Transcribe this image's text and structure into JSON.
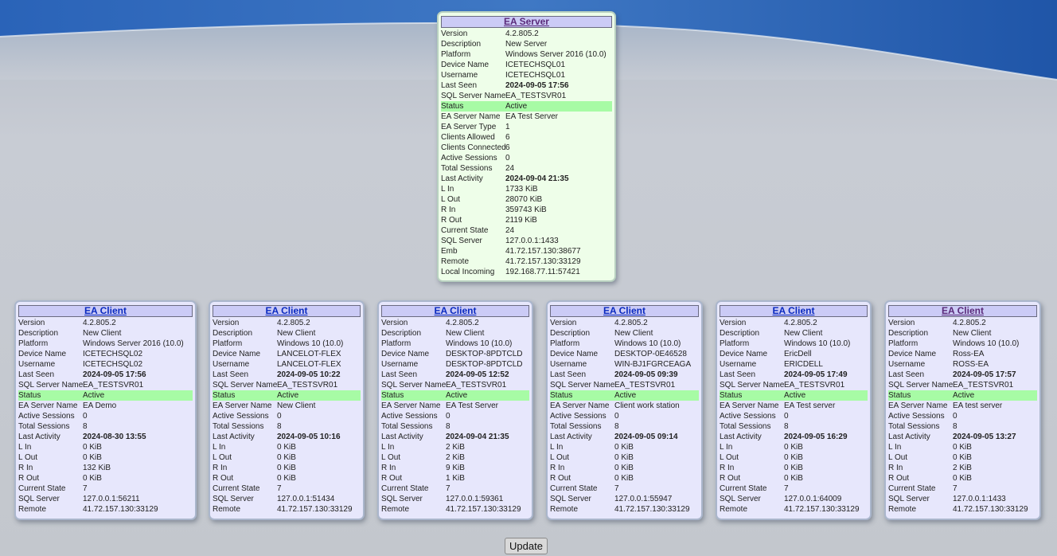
{
  "server": {
    "title": "EA Server",
    "rows": [
      {
        "label": "Version",
        "value": "4.2.805.2"
      },
      {
        "label": "Description",
        "value": "New Server"
      },
      {
        "label": "Platform",
        "value": "Windows Server 2016 (10.0)"
      },
      {
        "label": "Device Name",
        "value": "ICETECHSQL01"
      },
      {
        "label": "Username",
        "value": "ICETECHSQL01"
      },
      {
        "label": "Last Seen",
        "value": "2024-09-05 17:56",
        "bold": true
      },
      {
        "label": "SQL Server Name",
        "value": "EA_TESTSVR01"
      },
      {
        "label": "Status",
        "value": "Active",
        "status": "active"
      },
      {
        "label": "EA Server Name",
        "value": "EA Test Server"
      },
      {
        "label": "EA Server Type",
        "value": "1"
      },
      {
        "label": "Clients Allowed",
        "value": "6"
      },
      {
        "label": "Clients Connected",
        "value": "6"
      },
      {
        "label": "Active Sessions",
        "value": "0"
      },
      {
        "label": "Total Sessions",
        "value": "24"
      },
      {
        "label": "Last Activity",
        "value": "2024-09-04 21:35",
        "bold": true
      },
      {
        "label": "L In",
        "value": "1733 KiB"
      },
      {
        "label": "L Out",
        "value": "28070 KiB"
      },
      {
        "label": "R In",
        "value": "359743 KiB"
      },
      {
        "label": "R Out",
        "value": "2119 KiB"
      },
      {
        "label": "Current State",
        "value": "24"
      },
      {
        "label": "SQL Server",
        "value": "127.0.0.1:1433"
      },
      {
        "label": "Emb",
        "value": "41.72.157.130:38677"
      },
      {
        "label": "Remote",
        "value": "41.72.157.130:33129"
      },
      {
        "label": "Local Incoming",
        "value": "192.168.77.11:57421"
      }
    ]
  },
  "clients": [
    {
      "title": "EA Client",
      "rows": [
        {
          "label": "Version",
          "value": "4.2.805.2"
        },
        {
          "label": "Description",
          "value": "New Client"
        },
        {
          "label": "Platform",
          "value": "Windows Server 2016 (10.0)"
        },
        {
          "label": "Device Name",
          "value": "ICETECHSQL02"
        },
        {
          "label": "Username",
          "value": "ICETECHSQL02"
        },
        {
          "label": "Last Seen",
          "value": "2024-09-05 17:56",
          "bold": true
        },
        {
          "label": "SQL Server Name",
          "value": "EA_TESTSVR01"
        },
        {
          "label": "Status",
          "value": "Active",
          "status": "active"
        },
        {
          "label": "EA Server Name",
          "value": "EA Demo"
        },
        {
          "label": "Active Sessions",
          "value": "0"
        },
        {
          "label": "Total Sessions",
          "value": "8"
        },
        {
          "label": "Last Activity",
          "value": "2024-08-30 13:55",
          "bold": true
        },
        {
          "label": "L In",
          "value": "0 KiB"
        },
        {
          "label": "L Out",
          "value": "0 KiB"
        },
        {
          "label": "R In",
          "value": "132 KiB"
        },
        {
          "label": "R Out",
          "value": "0 KiB"
        },
        {
          "label": "Current State",
          "value": "7"
        },
        {
          "label": "SQL Server",
          "value": "127.0.0.1:56211"
        },
        {
          "label": "Remote",
          "value": "41.72.157.130:33129"
        }
      ]
    },
    {
      "title": "EA Client",
      "rows": [
        {
          "label": "Version",
          "value": "4.2.805.2"
        },
        {
          "label": "Description",
          "value": "New Client"
        },
        {
          "label": "Platform",
          "value": "Windows 10 (10.0)"
        },
        {
          "label": "Device Name",
          "value": "LANCELOT-FLEX"
        },
        {
          "label": "Username",
          "value": "LANCELOT-FLEX"
        },
        {
          "label": "Last Seen",
          "value": "2024-09-05 10:22",
          "bold": true
        },
        {
          "label": "SQL Server Name",
          "value": "EA_TESTSVR01"
        },
        {
          "label": "Status",
          "value": "Active",
          "status": "active"
        },
        {
          "label": "EA Server Name",
          "value": "New Client"
        },
        {
          "label": "Active Sessions",
          "value": "0"
        },
        {
          "label": "Total Sessions",
          "value": "8"
        },
        {
          "label": "Last Activity",
          "value": "2024-09-05 10:16",
          "bold": true
        },
        {
          "label": "L In",
          "value": "0 KiB"
        },
        {
          "label": "L Out",
          "value": "0 KiB"
        },
        {
          "label": "R In",
          "value": "0 KiB"
        },
        {
          "label": "R Out",
          "value": "0 KiB"
        },
        {
          "label": "Current State",
          "value": "7"
        },
        {
          "label": "SQL Server",
          "value": "127.0.0.1:51434"
        },
        {
          "label": "Remote",
          "value": "41.72.157.130:33129"
        }
      ]
    },
    {
      "title": "EA Client",
      "rows": [
        {
          "label": "Version",
          "value": "4.2.805.2"
        },
        {
          "label": "Description",
          "value": "New Client"
        },
        {
          "label": "Platform",
          "value": "Windows 10 (10.0)"
        },
        {
          "label": "Device Name",
          "value": "DESKTOP-8PDTCLD"
        },
        {
          "label": "Username",
          "value": "DESKTOP-8PDTCLD"
        },
        {
          "label": "Last Seen",
          "value": "2024-09-05 12:52",
          "bold": true
        },
        {
          "label": "SQL Server Name",
          "value": "EA_TESTSVR01"
        },
        {
          "label": "Status",
          "value": "Active",
          "status": "active"
        },
        {
          "label": "EA Server Name",
          "value": "EA Test Server"
        },
        {
          "label": "Active Sessions",
          "value": "0"
        },
        {
          "label": "Total Sessions",
          "value": "8"
        },
        {
          "label": "Last Activity",
          "value": "2024-09-04 21:35",
          "bold": true
        },
        {
          "label": "L In",
          "value": "2 KiB"
        },
        {
          "label": "L Out",
          "value": "2 KiB"
        },
        {
          "label": "R In",
          "value": "9 KiB"
        },
        {
          "label": "R Out",
          "value": "1 KiB"
        },
        {
          "label": "Current State",
          "value": "7"
        },
        {
          "label": "SQL Server",
          "value": "127.0.0.1:59361"
        },
        {
          "label": "Remote",
          "value": "41.72.157.130:33129"
        }
      ]
    },
    {
      "title": "EA Client",
      "rows": [
        {
          "label": "Version",
          "value": "4.2.805.2"
        },
        {
          "label": "Description",
          "value": "New Client"
        },
        {
          "label": "Platform",
          "value": "Windows 10 (10.0)"
        },
        {
          "label": "Device Name",
          "value": "DESKTOP-0E46528"
        },
        {
          "label": "Username",
          "value": "WIN-BJ1FGRCEAGA"
        },
        {
          "label": "Last Seen",
          "value": "2024-09-05 09:39",
          "bold": true
        },
        {
          "label": "SQL Server Name",
          "value": "EA_TESTSVR01"
        },
        {
          "label": "Status",
          "value": "Active",
          "status": "active"
        },
        {
          "label": "EA Server Name",
          "value": "Client work station"
        },
        {
          "label": "Active Sessions",
          "value": "0"
        },
        {
          "label": "Total Sessions",
          "value": "8"
        },
        {
          "label": "Last Activity",
          "value": "2024-09-05 09:14",
          "bold": true
        },
        {
          "label": "L In",
          "value": "0 KiB"
        },
        {
          "label": "L Out",
          "value": "0 KiB"
        },
        {
          "label": "R In",
          "value": "0 KiB"
        },
        {
          "label": "R Out",
          "value": "0 KiB"
        },
        {
          "label": "Current State",
          "value": "7"
        },
        {
          "label": "SQL Server",
          "value": "127.0.0.1:55947"
        },
        {
          "label": "Remote",
          "value": "41.72.157.130:33129"
        }
      ]
    },
    {
      "title": "EA Client",
      "rows": [
        {
          "label": "Version",
          "value": "4.2.805.2"
        },
        {
          "label": "Description",
          "value": "New Client"
        },
        {
          "label": "Platform",
          "value": "Windows 10 (10.0)"
        },
        {
          "label": "Device Name",
          "value": "EricDell"
        },
        {
          "label": "Username",
          "value": "ERICDELL"
        },
        {
          "label": "Last Seen",
          "value": "2024-09-05 17:49",
          "bold": true
        },
        {
          "label": "SQL Server Name",
          "value": "EA_TESTSVR01"
        },
        {
          "label": "Status",
          "value": "Active",
          "status": "active"
        },
        {
          "label": "EA Server Name",
          "value": "EA Test server"
        },
        {
          "label": "Active Sessions",
          "value": "0"
        },
        {
          "label": "Total Sessions",
          "value": "8"
        },
        {
          "label": "Last Activity",
          "value": "2024-09-05 16:29",
          "bold": true
        },
        {
          "label": "L In",
          "value": "0 KiB"
        },
        {
          "label": "L Out",
          "value": "0 KiB"
        },
        {
          "label": "R In",
          "value": "0 KiB"
        },
        {
          "label": "R Out",
          "value": "0 KiB"
        },
        {
          "label": "Current State",
          "value": "7"
        },
        {
          "label": "SQL Server",
          "value": "127.0.0.1:64009"
        },
        {
          "label": "Remote",
          "value": "41.72.157.130:33129"
        }
      ]
    },
    {
      "title": "EA Client",
      "rows": [
        {
          "label": "Version",
          "value": "4.2.805.2"
        },
        {
          "label": "Description",
          "value": "New Client"
        },
        {
          "label": "Platform",
          "value": "Windows 10 (10.0)"
        },
        {
          "label": "Device Name",
          "value": "Ross-EA"
        },
        {
          "label": "Username",
          "value": "ROSS-EA"
        },
        {
          "label": "Last Seen",
          "value": "2024-09-05 17:57",
          "bold": true
        },
        {
          "label": "SQL Server Name",
          "value": "EA_TESTSVR01"
        },
        {
          "label": "Status",
          "value": "Active",
          "status": "active"
        },
        {
          "label": "EA Server Name",
          "value": "EA test server"
        },
        {
          "label": "Active Sessions",
          "value": "0"
        },
        {
          "label": "Total Sessions",
          "value": "8"
        },
        {
          "label": "Last Activity",
          "value": "2024-09-05 13:27",
          "bold": true
        },
        {
          "label": "L In",
          "value": "0 KiB"
        },
        {
          "label": "L Out",
          "value": "0 KiB"
        },
        {
          "label": "R In",
          "value": "2 KiB"
        },
        {
          "label": "R Out",
          "value": "0 KiB"
        },
        {
          "label": "Current State",
          "value": "7"
        },
        {
          "label": "SQL Server",
          "value": "127.0.0.1:1433"
        },
        {
          "label": "Remote",
          "value": "41.72.157.130:33129"
        }
      ]
    }
  ],
  "update_button": {
    "label": "Update"
  },
  "colors": {
    "server_bg": "#eefee9",
    "client_bg": "#e7e7fc",
    "status_active": "#a7fba5",
    "title_bar": "#cbcbf6",
    "link": "#0a2ac0"
  }
}
